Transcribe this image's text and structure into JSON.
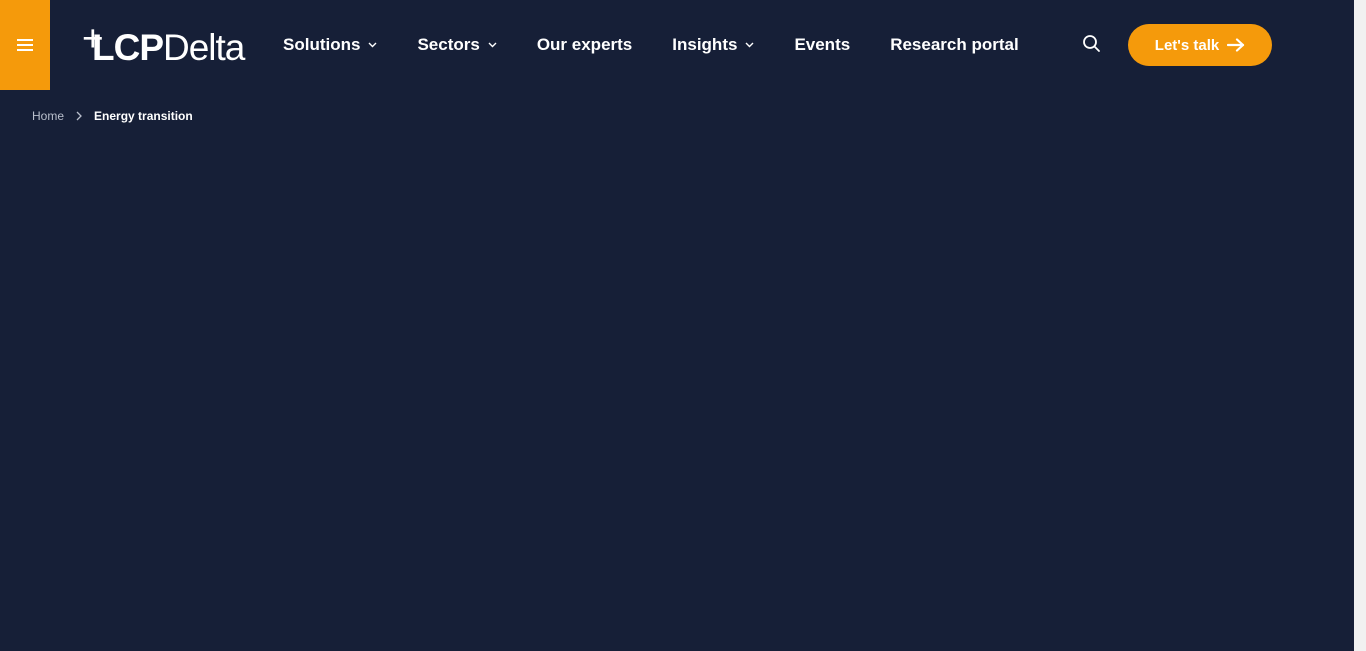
{
  "header": {
    "logo": {
      "prefix": "+",
      "part1": "LCP",
      "part2": "Delta"
    },
    "nav": [
      {
        "label": "Solutions",
        "has_dropdown": true
      },
      {
        "label": "Sectors",
        "has_dropdown": true
      },
      {
        "label": "Our experts",
        "has_dropdown": false
      },
      {
        "label": "Insights",
        "has_dropdown": true
      },
      {
        "label": "Events",
        "has_dropdown": false
      },
      {
        "label": "Research portal",
        "has_dropdown": false
      }
    ],
    "cta_label": "Let's talk"
  },
  "breadcrumb": {
    "home": "Home",
    "current": "Energy transition"
  },
  "colors": {
    "background": "#161f37",
    "accent": "#f59a0b",
    "text": "#ffffff",
    "muted": "#b9bfcc"
  },
  "icons": {
    "menu": "hamburger-icon",
    "search": "search-icon",
    "cta": "arrow-right-icon",
    "dropdown": "chevron-down-icon",
    "breadcrumb": "chevron-right-icon"
  }
}
